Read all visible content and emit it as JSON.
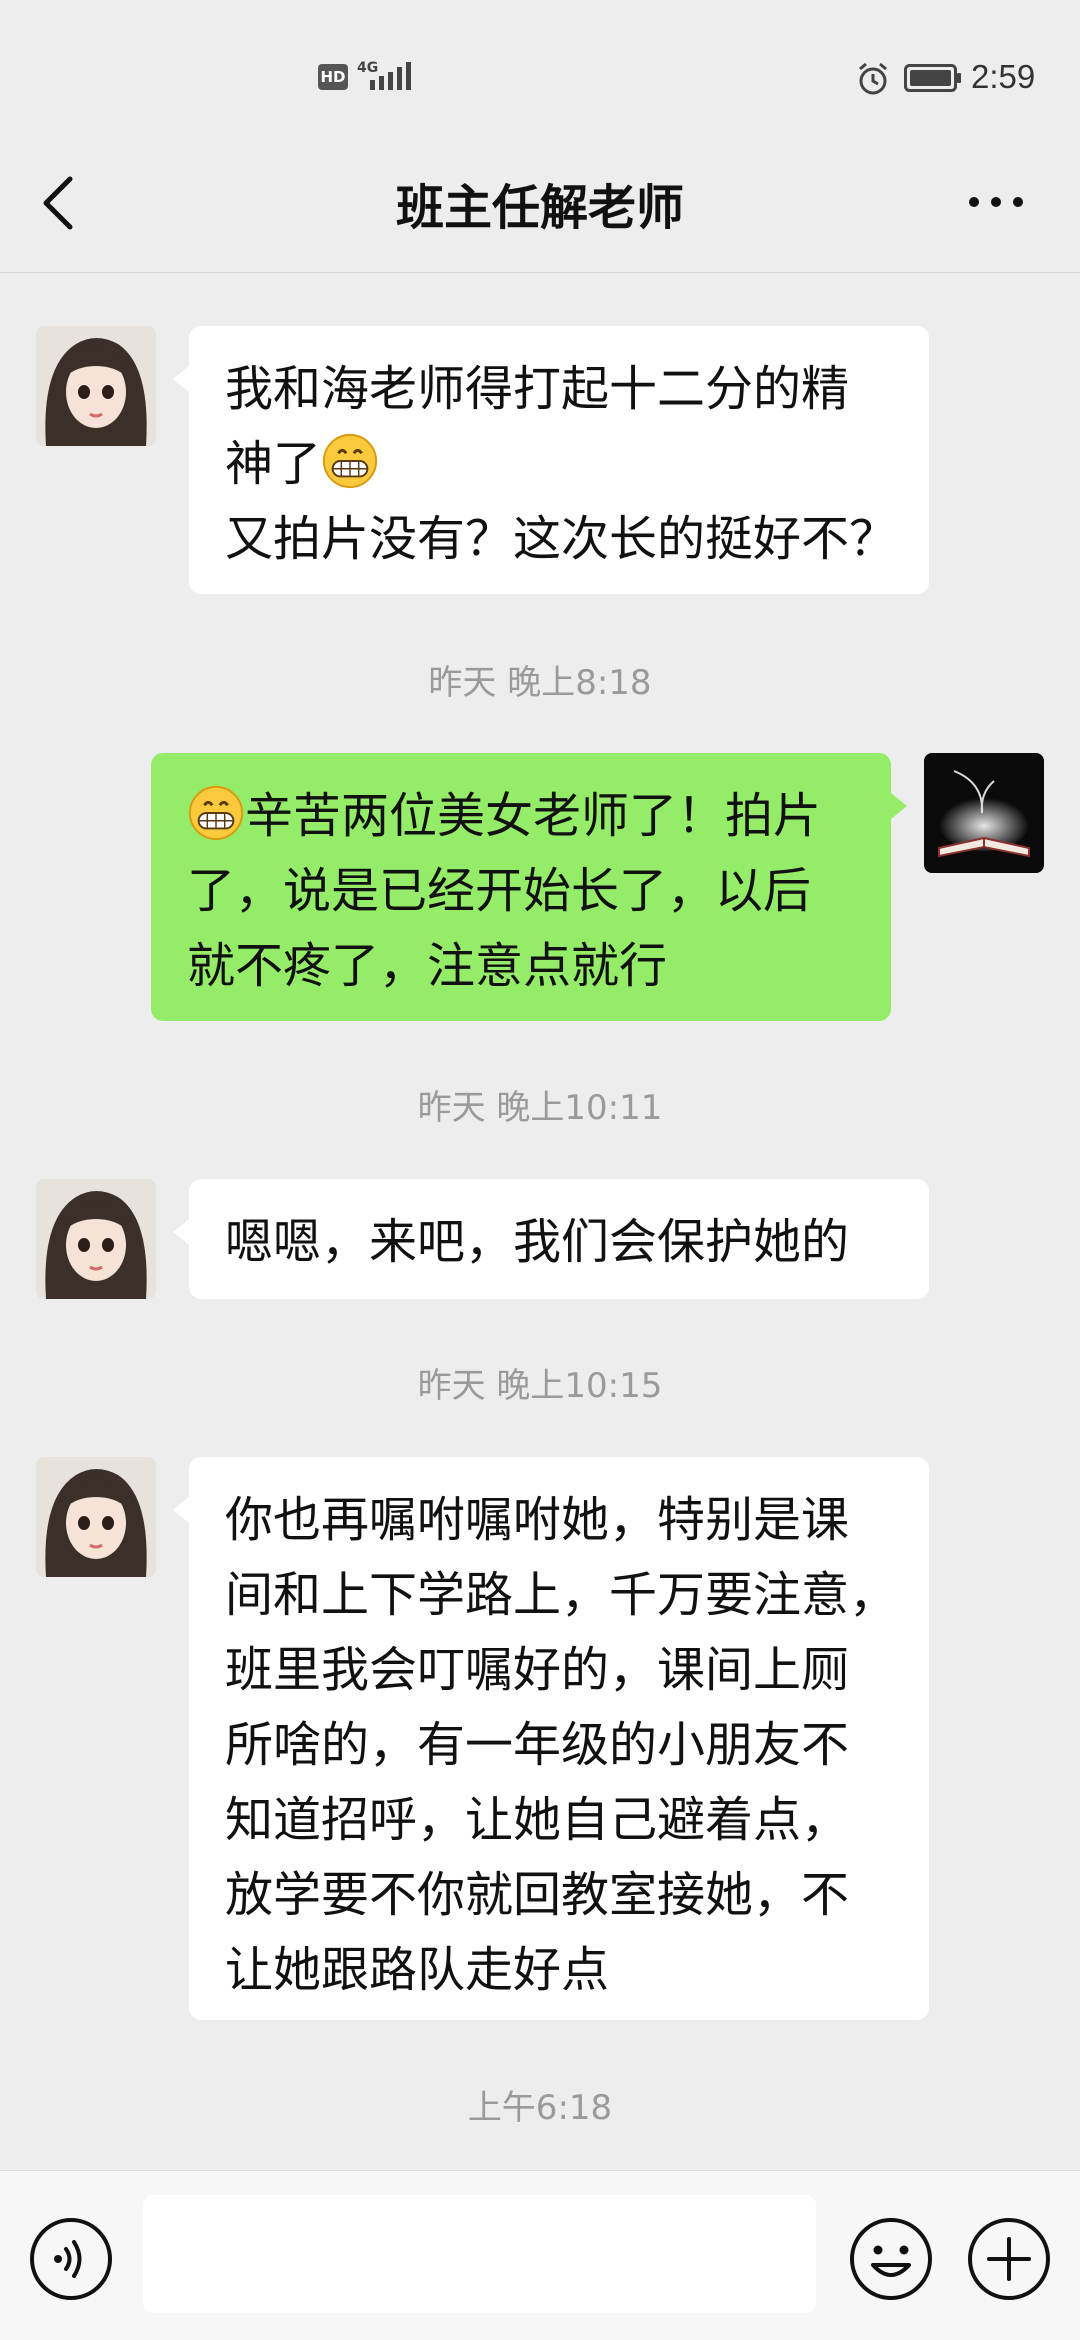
{
  "status_bar": {
    "hd_label": "HD",
    "network_label": "4G",
    "time": "2:59",
    "icons": [
      "signal-icon",
      "alarm-icon",
      "battery-icon"
    ]
  },
  "header": {
    "back_icon": "chevron-left-icon",
    "title": "班主任解老师",
    "more_icon": "more-dots-icon"
  },
  "messages": [
    {
      "from": "other",
      "lines": [
        "我和海老师得打起十二分的精",
        "神了",
        "又拍片没有？这次长的挺好不？"
      ],
      "emoji": "grin-emoji"
    },
    {
      "type": "timestamp",
      "text": "昨天 晚上8:18"
    },
    {
      "from": "self",
      "lines": [
        "辛苦两位美女老师了！拍片",
        "了，说是已经开始长了，以后",
        "就不疼了，注意点就行"
      ],
      "emoji": "grin-emoji"
    },
    {
      "type": "timestamp",
      "text": "昨天 晚上10:11"
    },
    {
      "from": "other",
      "lines": [
        "嗯嗯，来吧，我们会保护她的"
      ]
    },
    {
      "type": "timestamp",
      "text": "昨天 晚上10:15"
    },
    {
      "from": "other",
      "lines": [
        "你也再嘱咐嘱咐她，特别是课",
        "间和上下学路上，千万要注意，",
        "班里我会叮嘱好的，课间上厕",
        "所啥的，有一年级的小朋友不",
        "知道招呼，让她自己避着点，",
        "放学要不你就回教室接她，不",
        "让她跟路队走好点"
      ]
    },
    {
      "type": "timestamp",
      "text": "上午6:18"
    }
  ],
  "input_bar": {
    "voice_icon": "voice-icon",
    "input_value": "",
    "emoji_icon": "smiley-icon",
    "plus_icon": "plus-icon"
  },
  "colors": {
    "background": "#ededed",
    "incoming_bubble": "#ffffff",
    "outgoing_bubble": "#95ec69",
    "timestamp_text": "#9a9a9a"
  }
}
